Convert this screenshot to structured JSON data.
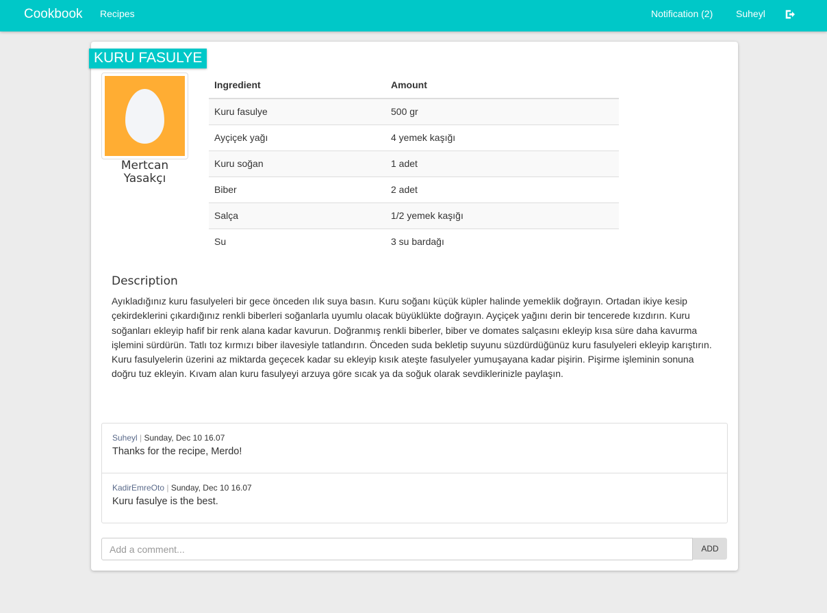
{
  "nav": {
    "brand": "Cookbook",
    "recipes": "Recipes",
    "notification": "Notification (2)",
    "user": "Suheyl"
  },
  "recipe": {
    "title": "KURU FASULYE",
    "author": "Mertcan Yasakçı",
    "headers": {
      "ingredient": "Ingredient",
      "amount": "Amount"
    },
    "ingredients": [
      {
        "name": "Kuru fasulye",
        "amount": "500 gr"
      },
      {
        "name": "Ayçiçek yağı",
        "amount": "4 yemek kaşığı"
      },
      {
        "name": "Kuru soğan",
        "amount": "1 adet"
      },
      {
        "name": "Biber",
        "amount": "2 adet"
      },
      {
        "name": "Salça",
        "amount": "1/2 yemek kaşığı"
      },
      {
        "name": "Su",
        "amount": "3 su bardağı"
      }
    ],
    "description_heading": "Description",
    "description": "Ayıkladığınız kuru fasulyeleri bir gece önceden ılık suya basın. Kuru soğanı küçük küpler halinde yemeklik doğrayın. Ortadan ikiye kesip çekirdeklerini çıkardığınız renkli biberleri soğanlarla uyumlu olacak büyüklükte doğrayın. Ayçiçek yağını derin bir tencerede kızdırın. Kuru soğanları ekleyip hafif bir renk alana kadar kavurun. Doğranmış renkli biberler, biber ve domates salçasını ekleyip kısa süre daha kavurma işlemini sürdürün. Tatlı toz kırmızı biber ilavesiyle tatlandırın. Önceden suda bekletip suyunu süzdürdüğünüz kuru fasulyeleri ekleyip karıştırın. Kuru fasulyelerin üzerini az miktarda geçecek kadar su ekleyip kısık ateşte fasulyeler yumuşayana kadar pişirin. Pişirme işleminin sonuna doğru tuz ekleyin. Kıvam alan kuru fasulyeyi arzuya göre sıcak ya da soğuk olarak sevdiklerinizle paylaşın."
  },
  "comments": [
    {
      "user": "Suheyl",
      "sep": " | ",
      "date": "Sunday, Dec 10 16.07",
      "text": "Thanks for the recipe, Merdo!"
    },
    {
      "user": "KadirEmreOto",
      "sep": " | ",
      "date": "Sunday, Dec 10 16.07",
      "text": "Kuru fasulye is the best."
    }
  ],
  "comment_form": {
    "placeholder": "Add a comment...",
    "button": "ADD"
  }
}
